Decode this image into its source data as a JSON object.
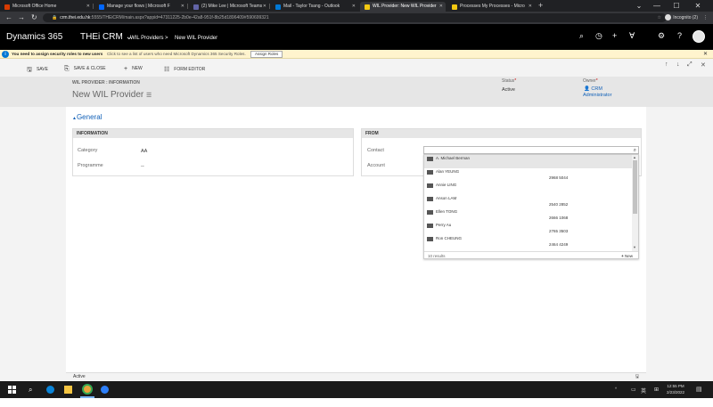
{
  "browser": {
    "tabs": [
      {
        "title": "Microsoft Office Home",
        "color": "#d83b01"
      },
      {
        "title": "Manage your flows | Microsoft F",
        "color": "#0066ff"
      },
      {
        "title": "(2) Mike Lee | Microsoft Teams",
        "color": "#6264a7"
      },
      {
        "title": "Mail - Taylor Tsang - Outlook",
        "color": "#0078d4"
      },
      {
        "title": "WIL Provider: New WIL Provider",
        "color": "#f2c811"
      },
      {
        "title": "Processes My Processes - Micro",
        "color": "#f2c811"
      }
    ],
    "new_tab": "+",
    "url_host": "crm.thei.edu.hk",
    "url_rest": ":5555/THEiCRM/main.aspx?appid=47311225-2b0e-42a8-951f-8b25d1896409#590699321",
    "incognito_label": "Incognito (2)"
  },
  "crm_nav": {
    "app_name": "Dynamics 365",
    "org_name": "THEi CRM",
    "breadcrumb_area": "WIL Providers",
    "breadcrumb_sep": ">",
    "breadcrumb_page": "New WIL Provider"
  },
  "notification": {
    "strong": "You need to assign security roles to new users",
    "text": "Click to see a list of users who need Microsoft Dynamics 365 Security Roles.",
    "button": "Assign Roles"
  },
  "commands": {
    "save": "SAVE",
    "save_close": "SAVE & CLOSE",
    "new": "NEW",
    "form_editor": "FORM EDITOR"
  },
  "header": {
    "entity_label": "WIL PROVIDER : INFORMATION",
    "title": "New WIL Provider",
    "status_label": "Status",
    "status_value": "Active",
    "owner_label": "Owner",
    "owner_value_1": "CRM",
    "owner_value_2": "Administrator",
    "required_mark": "*"
  },
  "section": {
    "title": "General",
    "info_panel": "INFORMATION",
    "from_panel": "FROM",
    "category_label": "Category",
    "category_value": "AA",
    "programme_label": "Programme",
    "programme_value": "--",
    "contact_label": "Contact",
    "account_label": "Account"
  },
  "lookup": {
    "results": [
      {
        "name": "A. Michael Berman",
        "phone": ""
      },
      {
        "name": "Alan YEUNG",
        "phone": "2968 5044"
      },
      {
        "name": "Annie LING",
        "phone": ""
      },
      {
        "name": "Anson LAM",
        "phone": "2540 2852"
      },
      {
        "name": "Ellen TONG",
        "phone": "2666 1068"
      },
      {
        "name": "Perry Au",
        "phone": "2765 3503"
      },
      {
        "name": "Ron CHEUNG",
        "phone": "2464 4249"
      }
    ],
    "count": "10 results",
    "new_label": "New"
  },
  "footer": {
    "status": "Active"
  },
  "taskbar": {
    "time": "12:55 PM",
    "date": "2/23/2022"
  }
}
